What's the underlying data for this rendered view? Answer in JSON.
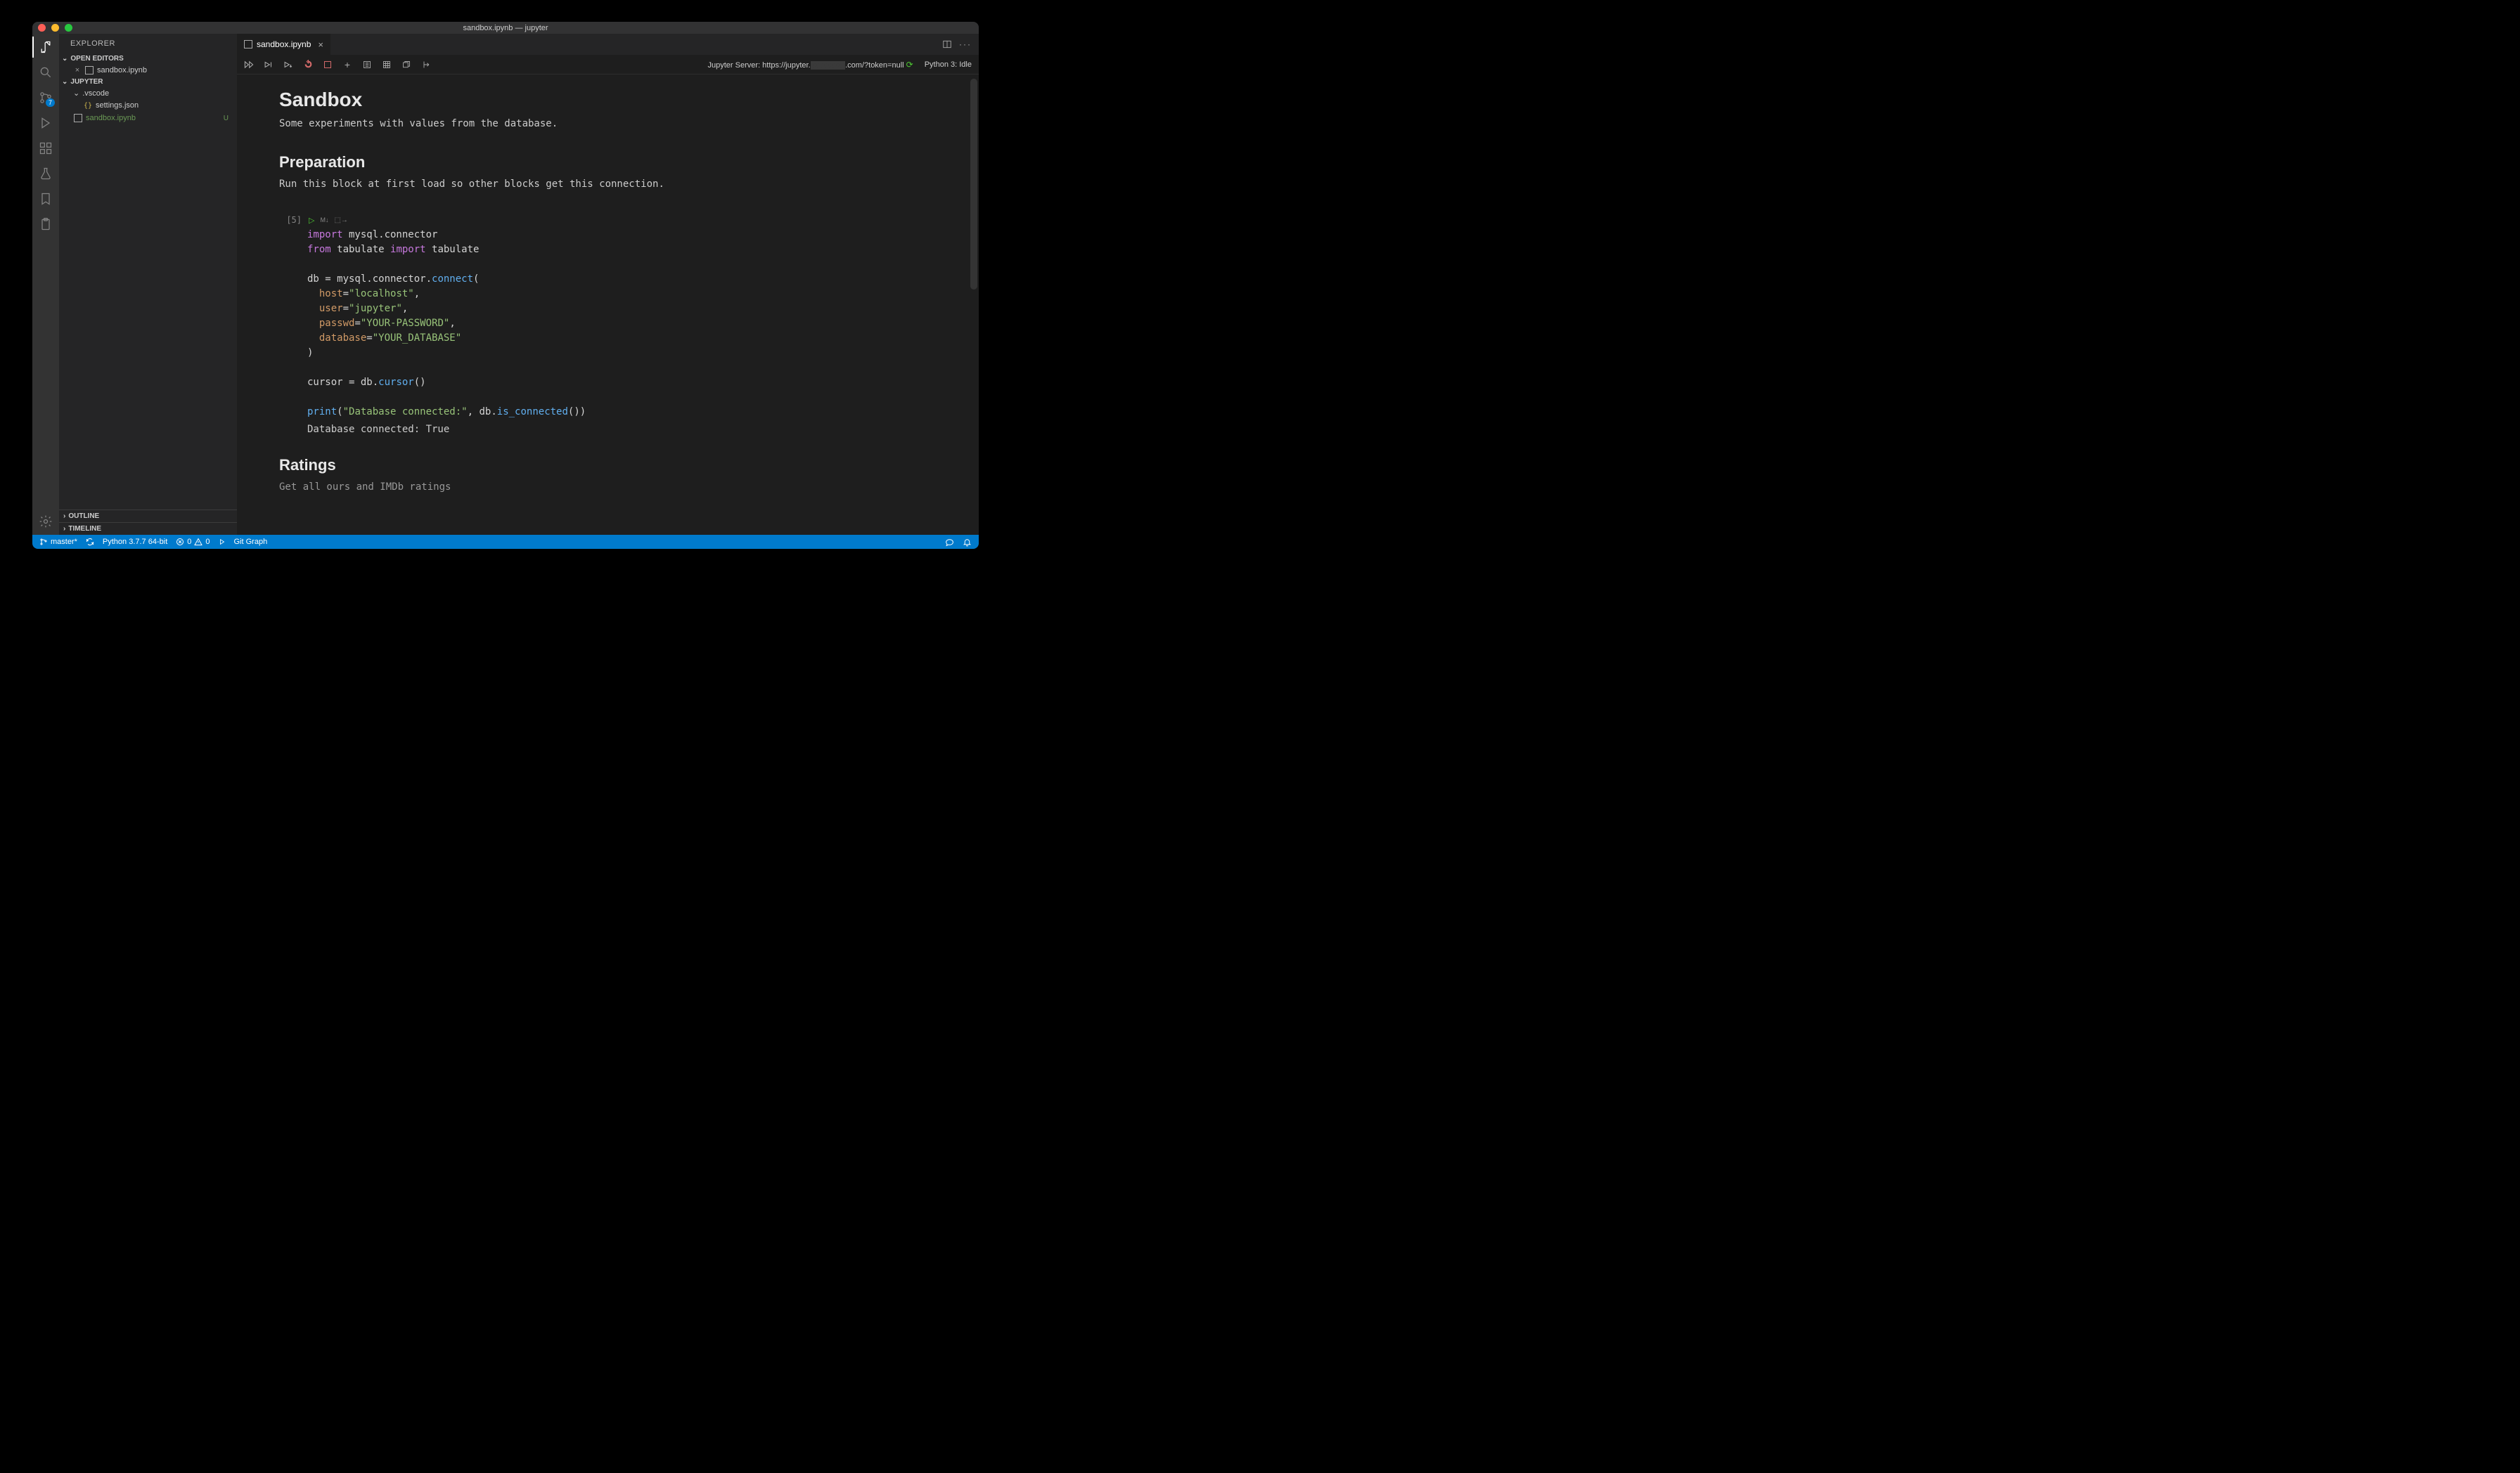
{
  "window_title": "sandbox.ipynb — jupyter",
  "explorer": {
    "title": "EXPLORER",
    "open_editors_label": "OPEN EDITORS",
    "open_editors": [
      {
        "name": "sandbox.ipynb"
      }
    ],
    "workspace_label": "JUPYTER",
    "tree": {
      "folder_vscode": ".vscode",
      "settings_json": "settings.json",
      "sandbox": "sandbox.ipynb",
      "sandbox_status": "U"
    },
    "outline_label": "OUTLINE",
    "timeline_label": "TIMELINE"
  },
  "scm_badge": "7",
  "tab": {
    "name": "sandbox.ipynb"
  },
  "nb_toolbar": {
    "server_label": "Jupyter Server: https://jupyter.",
    "server_suffix": ".com/?token=null",
    "kernel_label": "Python 3: Idle"
  },
  "notebook": {
    "h1": "Sandbox",
    "p1": "Some experiments with values from the database.",
    "h2a": "Preparation",
    "p2": "Run this block at first load so other blocks get this connection.",
    "cell1_prompt": "[5]",
    "cell1_code": {
      "l1_kw": "import",
      "l1_rest": " mysql.connector",
      "l2_kw1": "from",
      "l2_mid": " tabulate ",
      "l2_kw2": "import",
      "l2_rest": " tabulate",
      "l4_a": "db = mysql.connector.",
      "l4_fn": "connect",
      "l4_b": "(",
      "l5_arg": "host",
      "l5_eq": "=",
      "l5_str": "\"localhost\"",
      "l5_c": ",",
      "l6_arg": "user",
      "l6_eq": "=",
      "l6_str": "\"jupyter\"",
      "l6_c": ",",
      "l7_arg": "passwd",
      "l7_eq": "=",
      "l7_str": "\"YOUR-PASSWORD\"",
      "l7_c": ",",
      "l8_arg": "database",
      "l8_eq": "=",
      "l8_str": "\"YOUR_DATABASE\"",
      "l9": ")",
      "l11_a": "cursor = db.",
      "l11_fn": "cursor",
      "l11_b": "()",
      "l13_fn": "print",
      "l13_a": "(",
      "l13_str": "\"Database connected:\"",
      "l13_b": ", db.",
      "l13_fn2": "is_connected",
      "l13_c": "())"
    },
    "cell1_output": "Database connected: True",
    "h2b": "Ratings",
    "p3": "Get all ours and IMDb ratings"
  },
  "statusbar": {
    "branch": "master*",
    "python": "Python 3.7.7 64-bit",
    "errors": "0",
    "warnings": "0",
    "git_graph": "Git Graph"
  }
}
